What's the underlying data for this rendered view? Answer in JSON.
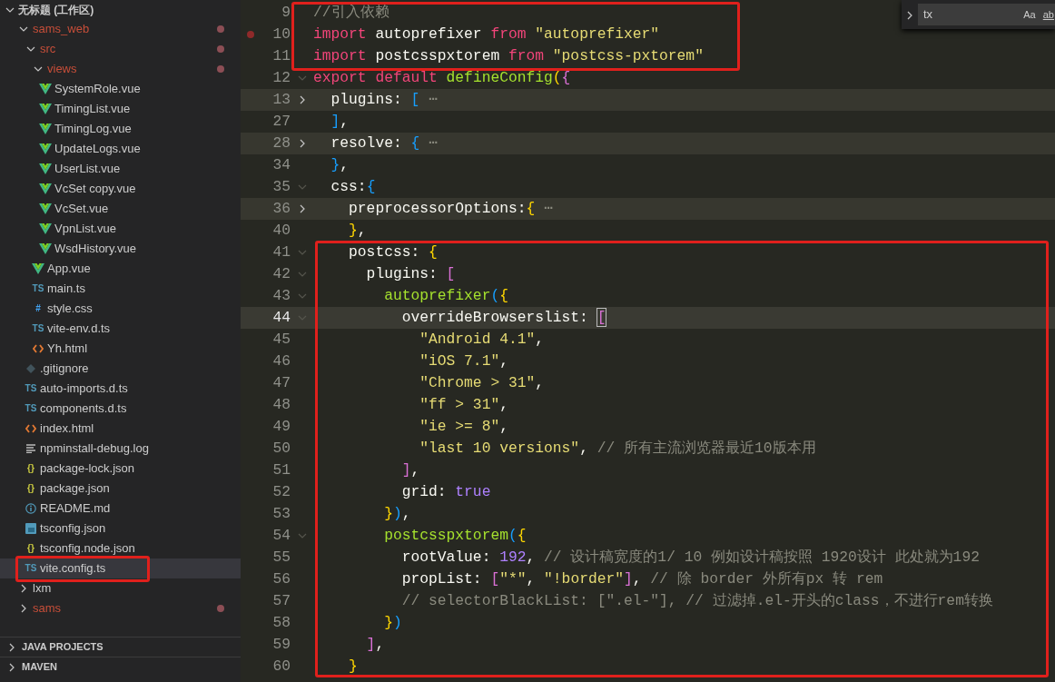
{
  "explorer": {
    "title": "无标题 (工作区)",
    "expanded": true,
    "items": [
      {
        "label": "sams_web",
        "kind": "folder",
        "expanded": true,
        "modified": true,
        "selected": false,
        "children": [
          {
            "label": "src",
            "kind": "folder",
            "expanded": true,
            "modified": true,
            "selected": false,
            "children": [
              {
                "label": "views",
                "kind": "folder",
                "expanded": true,
                "modified": true,
                "selected": false,
                "children": [
                  {
                    "label": "SystemRole.vue",
                    "kind": "vue",
                    "selected": false
                  },
                  {
                    "label": "TimingList.vue",
                    "kind": "vue",
                    "selected": false
                  },
                  {
                    "label": "TimingLog.vue",
                    "kind": "vue",
                    "selected": false
                  },
                  {
                    "label": "UpdateLogs.vue",
                    "kind": "vue",
                    "selected": false
                  },
                  {
                    "label": "UserList.vue",
                    "kind": "vue",
                    "selected": false
                  },
                  {
                    "label": "VcSet copy.vue",
                    "kind": "vue",
                    "selected": false
                  },
                  {
                    "label": "VcSet.vue",
                    "kind": "vue",
                    "selected": false
                  },
                  {
                    "label": "VpnList.vue",
                    "kind": "vue",
                    "selected": false
                  },
                  {
                    "label": "WsdHistory.vue",
                    "kind": "vue",
                    "selected": false
                  }
                ]
              },
              {
                "label": "App.vue",
                "kind": "vue",
                "selected": false
              },
              {
                "label": "main.ts",
                "kind": "ts",
                "icon_text": "TS",
                "selected": false
              },
              {
                "label": "style.css",
                "kind": "css",
                "icon_text": "#",
                "selected": false
              },
              {
                "label": "vite-env.d.ts",
                "kind": "ts",
                "icon_text": "TS",
                "selected": false
              },
              {
                "label": "Yh.html",
                "kind": "html",
                "selected": false
              }
            ]
          },
          {
            "label": ".gitignore",
            "kind": "git",
            "selected": false
          },
          {
            "label": "auto-imports.d.ts",
            "kind": "ts",
            "icon_text": "TS",
            "selected": false
          },
          {
            "label": "components.d.ts",
            "kind": "ts",
            "icon_text": "TS",
            "selected": false
          },
          {
            "label": "index.html",
            "kind": "html",
            "selected": false
          },
          {
            "label": "npminstall-debug.log",
            "kind": "log",
            "selected": false
          },
          {
            "label": "package-lock.json",
            "kind": "json",
            "icon_text": "{}",
            "selected": false
          },
          {
            "label": "package.json",
            "kind": "json",
            "icon_text": "{}",
            "selected": false
          },
          {
            "label": "README.md",
            "kind": "info",
            "selected": false
          },
          {
            "label": "tsconfig.json",
            "kind": "tsconfig",
            "selected": false
          },
          {
            "label": "tsconfig.node.json",
            "kind": "json",
            "icon_text": "{}",
            "selected": false
          },
          {
            "label": "vite.config.ts",
            "kind": "ts",
            "icon_text": "TS",
            "selected": true,
            "boxed": true
          }
        ]
      },
      {
        "label": "lxm",
        "kind": "folder",
        "expanded": false,
        "modified": false,
        "selected": false
      },
      {
        "label": "sams",
        "kind": "folder",
        "expanded": false,
        "modified": true,
        "selected": false
      }
    ]
  },
  "sections": [
    {
      "title": "JAVA PROJECTS",
      "expanded": false
    },
    {
      "title": "MAVEN",
      "expanded": false
    }
  ],
  "find_widget": {
    "value": "tx",
    "options": [
      "Aa",
      "ab"
    ]
  },
  "code_blocks": [
    {
      "boxed": true,
      "lines": [
        {
          "number": "9",
          "tokens": [
            {
              "kind": "cmt",
              "text": "//引入依赖"
            }
          ]
        },
        {
          "number": "10",
          "breakpoint": true,
          "tokens": [
            {
              "kind": "kw",
              "text": "import"
            },
            {
              "kind": "id",
              "text": " autoprefixer "
            },
            {
              "kind": "kw",
              "text": "from"
            },
            {
              "kind": "str",
              "text": " \"autoprefixer\""
            }
          ]
        },
        {
          "number": "11",
          "tokens": [
            {
              "kind": "kw",
              "text": "import"
            },
            {
              "kind": "id",
              "text": " postcsspxtorem "
            },
            {
              "kind": "kw",
              "text": "from"
            },
            {
              "kind": "str",
              "text": " \"postcss-pxtorem\""
            }
          ]
        }
      ]
    },
    {
      "lines": [
        {
          "number": "12",
          "collapsed": false,
          "tokens": [
            {
              "kind": "kw",
              "text": "export default"
            },
            {
              "kind": "fn",
              "text": " defineConfig"
            },
            {
              "kind": "b1",
              "text": "("
            },
            {
              "kind": "b2",
              "text": "{"
            }
          ]
        },
        {
          "number": "13",
          "collapsed": true,
          "tokens": [
            {
              "kind": "id",
              "text": "  plugins: "
            },
            {
              "kind": "b3",
              "text": "["
            },
            {
              "kind": "fold",
              "text": " ⋯"
            }
          ]
        },
        {
          "number": "27",
          "tokens": [
            {
              "kind": "b3",
              "text": "  ]"
            },
            {
              "kind": "id",
              "text": ","
            }
          ]
        },
        {
          "number": "28",
          "collapsed": true,
          "tokens": [
            {
              "kind": "id",
              "text": "  resolve: "
            },
            {
              "kind": "b3",
              "text": "{"
            },
            {
              "kind": "fold",
              "text": " ⋯"
            }
          ]
        },
        {
          "number": "34",
          "tokens": [
            {
              "kind": "b3",
              "text": "  }"
            },
            {
              "kind": "id",
              "text": ","
            }
          ]
        },
        {
          "number": "35",
          "collapsed": false,
          "tokens": [
            {
              "kind": "id",
              "text": "  css:"
            },
            {
              "kind": "b3",
              "text": "{"
            }
          ]
        },
        {
          "number": "36",
          "collapsed": true,
          "tokens": [
            {
              "kind": "id",
              "text": "    preprocessorOptions:"
            },
            {
              "kind": "b1",
              "text": "{"
            },
            {
              "kind": "fold",
              "text": " ⋯"
            }
          ]
        },
        {
          "number": "40",
          "tokens": [
            {
              "kind": "b1",
              "text": "    }"
            },
            {
              "kind": "id",
              "text": ","
            }
          ]
        }
      ]
    },
    {
      "boxed": true,
      "lines": [
        {
          "number": "41",
          "collapsed": false,
          "tokens": [
            {
              "kind": "id",
              "text": "    postcss: "
            },
            {
              "kind": "b1",
              "text": "{"
            }
          ]
        },
        {
          "number": "42",
          "collapsed": false,
          "tokens": [
            {
              "kind": "id",
              "text": "      plugins: "
            },
            {
              "kind": "b2",
              "text": "["
            }
          ]
        },
        {
          "number": "43",
          "collapsed": false,
          "tokens": [
            {
              "kind": "fn",
              "text": "        autoprefixer"
            },
            {
              "kind": "b3",
              "text": "("
            },
            {
              "kind": "b1",
              "text": "{"
            }
          ]
        },
        {
          "number": "44",
          "collapsed": false,
          "current": true,
          "tokens": [
            {
              "kind": "id",
              "text": "          overrideBrowserslist: "
            },
            {
              "kind": "b2",
              "text": "["
            }
          ]
        },
        {
          "number": "45",
          "tokens": [
            {
              "kind": "str",
              "text": "            \"Android 4.1\""
            },
            {
              "kind": "id",
              "text": ","
            }
          ]
        },
        {
          "number": "46",
          "tokens": [
            {
              "kind": "str",
              "text": "            \"iOS 7.1\""
            },
            {
              "kind": "id",
              "text": ","
            }
          ]
        },
        {
          "number": "47",
          "tokens": [
            {
              "kind": "str",
              "text": "            \"Chrome > 31\""
            },
            {
              "kind": "id",
              "text": ","
            }
          ]
        },
        {
          "number": "48",
          "tokens": [
            {
              "kind": "str",
              "text": "            \"ff > 31\""
            },
            {
              "kind": "id",
              "text": ","
            }
          ]
        },
        {
          "number": "49",
          "tokens": [
            {
              "kind": "str",
              "text": "            \"ie >= 8\""
            },
            {
              "kind": "id",
              "text": ","
            }
          ]
        },
        {
          "number": "50",
          "tokens": [
            {
              "kind": "str",
              "text": "            \"last 10 versions\""
            },
            {
              "kind": "id",
              "text": ","
            },
            {
              "kind": "cmt",
              "text": " // 所有主流浏览器最近10版本用"
            }
          ]
        },
        {
          "number": "51",
          "tokens": [
            {
              "kind": "b2",
              "text": "          ]"
            },
            {
              "kind": "id",
              "text": ","
            }
          ]
        },
        {
          "number": "52",
          "tokens": [
            {
              "kind": "id",
              "text": "          grid: "
            },
            {
              "kind": "num",
              "text": "true"
            }
          ]
        },
        {
          "number": "53",
          "tokens": [
            {
              "kind": "b1",
              "text": "        }"
            },
            {
              "kind": "b3",
              "text": ")"
            },
            {
              "kind": "id",
              "text": ","
            }
          ]
        },
        {
          "number": "54",
          "collapsed": false,
          "tokens": [
            {
              "kind": "fn",
              "text": "        postcsspxtorem"
            },
            {
              "kind": "b3",
              "text": "("
            },
            {
              "kind": "b1",
              "text": "{"
            }
          ]
        },
        {
          "number": "55",
          "tokens": [
            {
              "kind": "id",
              "text": "          rootValue: "
            },
            {
              "kind": "num",
              "text": "192"
            },
            {
              "kind": "id",
              "text": ","
            },
            {
              "kind": "cmt",
              "text": " // 设计稿宽度的1/ 10 例如设计稿按照 1920设计 此处就为192"
            }
          ]
        },
        {
          "number": "56",
          "tokens": [
            {
              "kind": "id",
              "text": "          propList: "
            },
            {
              "kind": "b2",
              "text": "["
            },
            {
              "kind": "str",
              "text": "\"*\""
            },
            {
              "kind": "id",
              "text": ","
            },
            {
              "kind": "str",
              "text": " \"!border\""
            },
            {
              "kind": "b2",
              "text": "]"
            },
            {
              "kind": "id",
              "text": ","
            },
            {
              "kind": "cmt",
              "text": " // 除 border 外所有px 转 rem"
            }
          ]
        },
        {
          "number": "57",
          "tokens": [
            {
              "kind": "cmt",
              "text": "          // selectorBlackList: [\".el-\"], // 过滤掉.el-开头的class，不进行rem转换"
            }
          ]
        },
        {
          "number": "58",
          "tokens": [
            {
              "kind": "b1",
              "text": "        }"
            },
            {
              "kind": "b3",
              "text": ")"
            }
          ]
        },
        {
          "number": "59",
          "tokens": [
            {
              "kind": "b2",
              "text": "      ]"
            },
            {
              "kind": "id",
              "text": ","
            }
          ]
        },
        {
          "number": "60",
          "tokens": [
            {
              "kind": "b1",
              "text": "    }"
            }
          ]
        }
      ]
    }
  ]
}
